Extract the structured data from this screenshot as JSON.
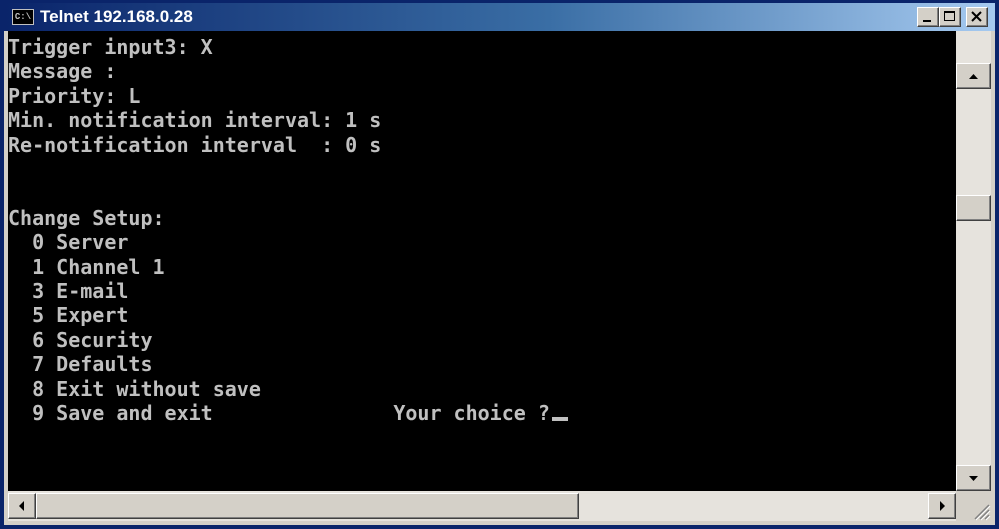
{
  "window": {
    "title": "Telnet 192.168.0.28",
    "icon": "console-icon",
    "icon_glyph": "C:\\"
  },
  "console": {
    "lines": [
      "Trigger input3: X",
      "Message :",
      "Priority: L",
      "Min. notification interval: 1 s",
      "Re-notification interval  : 0 s",
      "",
      "",
      "Change Setup:",
      "  0 Server",
      "  1 Channel 1",
      "  3 E-mail",
      "  5 Expert",
      "  6 Security",
      "  7 Defaults",
      "  8 Exit without save",
      "  9 Save and exit"
    ],
    "prompt": "Your choice ?",
    "prompt_gap": "               "
  },
  "colors": {
    "console_bg": "#000000",
    "console_fg": "#c0c0c0",
    "titlebar_start": "#0a246a",
    "titlebar_end": "#a6caf0"
  }
}
